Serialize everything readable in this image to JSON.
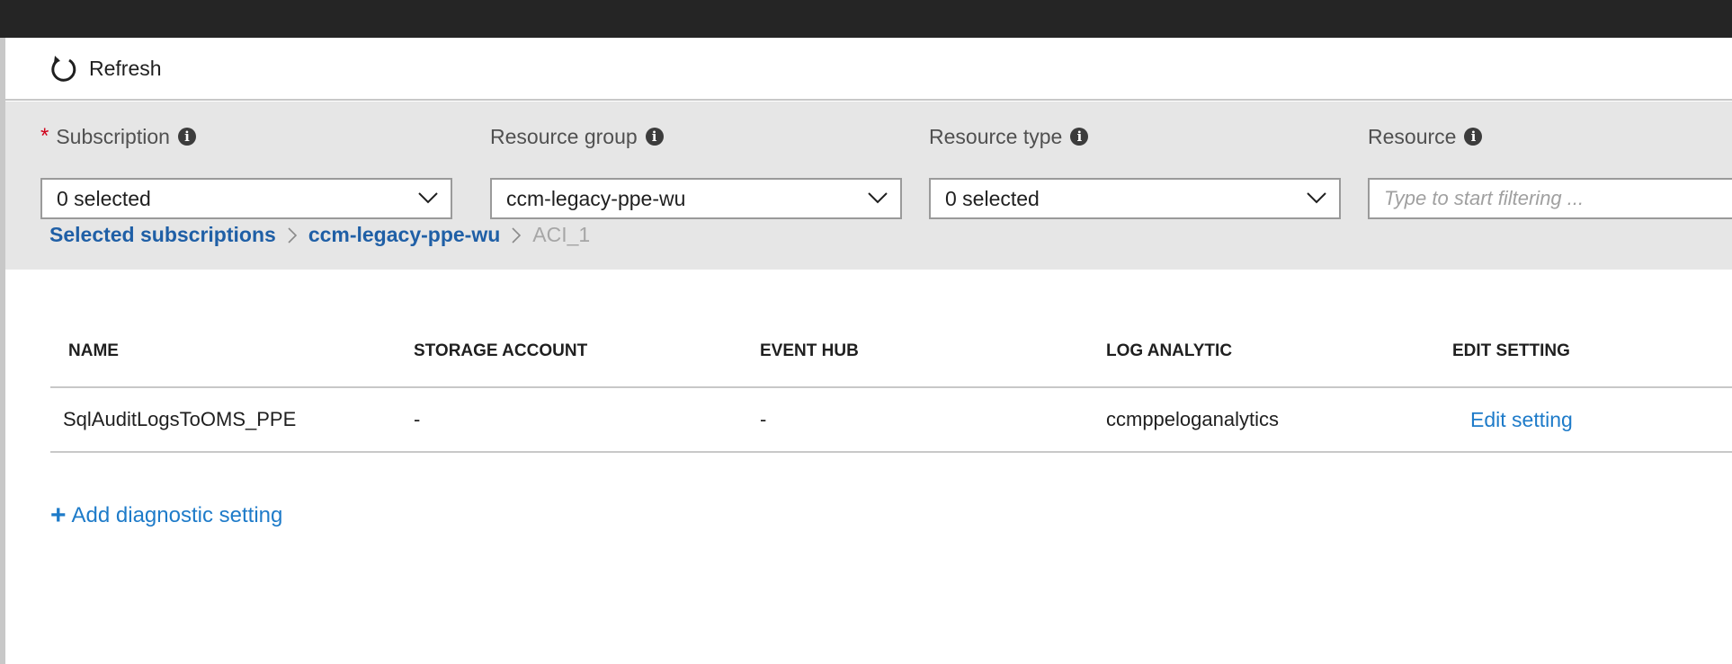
{
  "toolbar": {
    "refresh_label": "Refresh"
  },
  "filters": {
    "subscription": {
      "label": "Subscription",
      "required_marker": "*",
      "value": "0 selected"
    },
    "resource_group": {
      "label": "Resource group",
      "value": "ccm-legacy-ppe-wu"
    },
    "resource_type": {
      "label": "Resource type",
      "value": "0 selected"
    },
    "resource": {
      "label": "Resource",
      "placeholder": "Type to start filtering ..."
    }
  },
  "breadcrumb": {
    "items": [
      "Selected subscriptions",
      "ccm-legacy-ppe-wu",
      "ACI_1"
    ]
  },
  "table": {
    "columns": [
      "NAME",
      "STORAGE ACCOUNT",
      "EVENT HUB",
      "LOG ANALYTIC",
      "EDIT SETTING"
    ],
    "rows": [
      {
        "name": "SqlAuditLogsToOMS_PPE",
        "storage_account": "-",
        "event_hub": "-",
        "log_analytic": "ccmppeloganalytics",
        "edit_setting": "Edit setting"
      }
    ]
  },
  "add_setting": {
    "plus": "+",
    "label": "Add diagnostic setting"
  },
  "colors": {
    "link": "#1e7bc9",
    "breadcrumb_link": "#1f5fa6",
    "required": "#d0021b",
    "filter_bg": "#e6e6e6",
    "topbar": "#252525"
  },
  "icons": {
    "refresh": "refresh-icon",
    "info": "info-icon",
    "chevron": "chevron-down-icon",
    "breadcrumb_separator": "chevron-right-icon",
    "add": "plus-icon"
  }
}
